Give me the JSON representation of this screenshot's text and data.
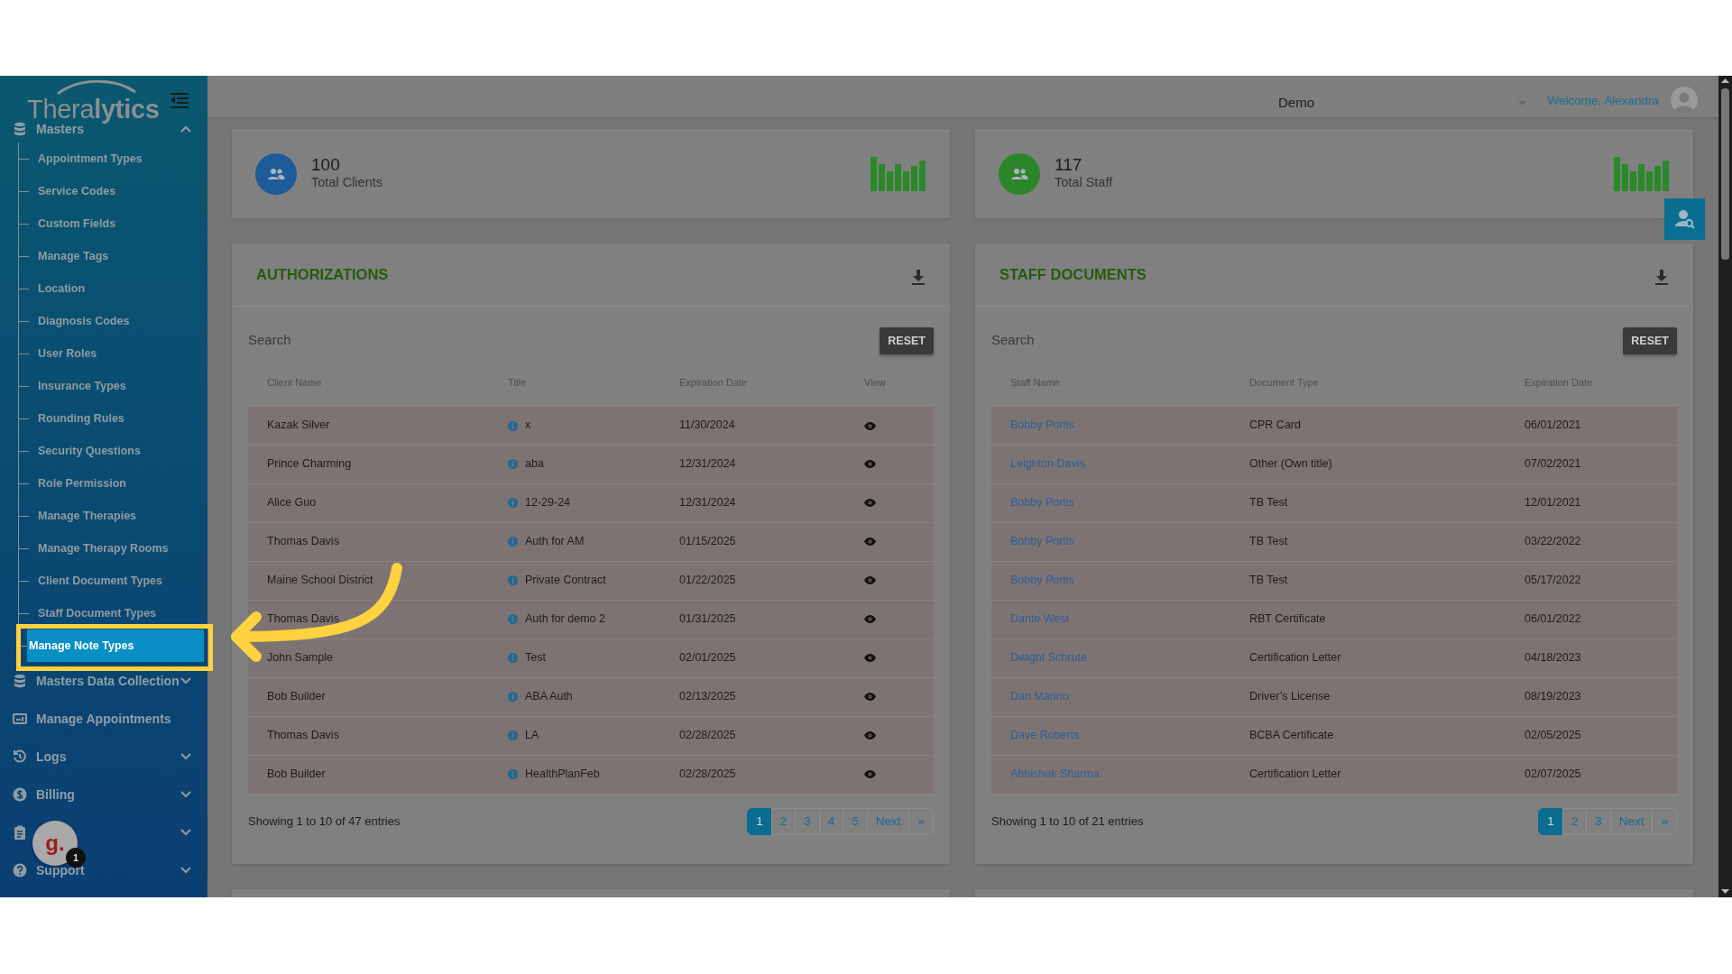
{
  "sidebar": {
    "logo": "Thera**lytics**",
    "groups": [
      {
        "kind": "database",
        "label": "Masters",
        "expanded": true,
        "children": [
          {
            "label": "Appointment Types",
            "selected": false
          },
          {
            "label": "Service Codes",
            "selected": false
          },
          {
            "label": "Custom Fields",
            "selected": false
          },
          {
            "label": "Manage Tags",
            "selected": false
          },
          {
            "label": "Location",
            "selected": false
          },
          {
            "label": "Diagnosis Codes",
            "selected": false
          },
          {
            "label": "User Roles",
            "selected": false
          },
          {
            "label": "Insurance Types",
            "selected": false
          },
          {
            "label": "Rounding Rules",
            "selected": false
          },
          {
            "label": "Security Questions",
            "selected": false
          },
          {
            "label": "Role Permission",
            "selected": false
          },
          {
            "label": "Manage Therapies",
            "selected": false
          },
          {
            "label": "Manage Therapy Rooms",
            "selected": false
          },
          {
            "label": "Client Document Types",
            "selected": false
          },
          {
            "label": "Staff Document Types",
            "selected": false
          },
          {
            "label": "Manage Note Types",
            "selected": true
          }
        ]
      },
      {
        "kind": "database",
        "label": "Masters Data Collection",
        "expanded": false
      },
      {
        "kind": "id-card",
        "label": "Manage Appointments"
      },
      {
        "kind": "history",
        "label": "Logs",
        "expanded": false
      },
      {
        "kind": "billing",
        "label": "Billing",
        "expanded": false
      },
      {
        "kind": "clipboard",
        "expanded": false
      },
      {
        "kind": "help",
        "label": "Support",
        "expanded": false
      }
    ]
  },
  "chat_widget": {
    "logo": "g.",
    "badge": "1"
  },
  "header": {
    "site": "Demo",
    "welcome": "Welcome, Alexandra"
  },
  "stats": [
    {
      "value": "100",
      "label": "Total Clients",
      "color": "#1d5c98"
    },
    {
      "value": "117",
      "label": "Total Staff",
      "color": "#2b852b"
    }
  ],
  "panels": [
    {
      "title": "AUTHORIZATIONS",
      "search_placeholder": "Search",
      "reset": "RESET",
      "columns": [
        {
          "label": "Client Name",
          "kind": "text"
        },
        {
          "label": "Title",
          "kind": "info"
        },
        {
          "label": "Expiration Date",
          "kind": "text"
        },
        {
          "label": "View",
          "kind": "view"
        }
      ],
      "rows": [
        [
          "Kazak Silver",
          "x",
          "11/30/2024"
        ],
        [
          "Prince Charming",
          "aba",
          "12/31/2024"
        ],
        [
          "Alice Guo",
          "12-29-24",
          "12/31/2024"
        ],
        [
          "Thomas Davis",
          "Auth for AM",
          "01/15/2025"
        ],
        [
          "Maine School District",
          "Private Contract",
          "01/22/2025"
        ],
        [
          "Thomas Davis",
          "Auth for demo 2",
          "01/31/2025"
        ],
        [
          "John Sample",
          "Test",
          "02/01/2025"
        ],
        [
          "Bob Builder",
          "ABA Auth",
          "02/13/2025"
        ],
        [
          "Thomas Davis",
          "LA",
          "02/28/2025"
        ],
        [
          "Bob Builder",
          "HealthPlanFeb",
          "02/28/2025"
        ]
      ],
      "info": "Showing 1 to 10 of 47 entries",
      "pages": [
        {
          "label": "1",
          "selected": true
        },
        {
          "label": "2",
          "selected": false
        },
        {
          "label": "3",
          "selected": false
        },
        {
          "label": "4",
          "selected": false
        },
        {
          "label": "5",
          "selected": false
        },
        {
          "label": "Next",
          "selected": false
        },
        {
          "label": "»",
          "selected": false
        }
      ]
    },
    {
      "title": "STAFF DOCUMENTS",
      "search_placeholder": "Search",
      "reset": "RESET",
      "columns": [
        {
          "label": "Staff Name",
          "kind": "link"
        },
        {
          "label": "Document Type",
          "kind": "text"
        },
        {
          "label": "Expiration Date",
          "kind": "text"
        }
      ],
      "rows": [
        [
          "Bobby Portis",
          "CPR Card",
          "06/01/2021"
        ],
        [
          "Leighton Davis",
          "Other (Own title)",
          "07/02/2021"
        ],
        [
          "Bobby Portis",
          "TB Test",
          "12/01/2021"
        ],
        [
          "Bobby Portis",
          "TB Test",
          "03/22/2022"
        ],
        [
          "Bobby Portis",
          "TB Test",
          "05/17/2022"
        ],
        [
          "Dante West",
          "RBT Certificate",
          "06/01/2022"
        ],
        [
          "Dwight Schrute",
          "Certification Letter",
          "04/18/2023"
        ],
        [
          "Dan Marino",
          "Driver’s License",
          "08/19/2023"
        ],
        [
          "Dave Roberts",
          "BCBA Certificate",
          "02/05/2025"
        ],
        [
          "Abhishek Sharma",
          "Certification Letter",
          "02/07/2025"
        ]
      ],
      "info": "Showing 1 to 10 of 21 entries",
      "pages": [
        {
          "label": "1",
          "selected": true
        },
        {
          "label": "2",
          "selected": false
        },
        {
          "label": "3",
          "selected": false
        },
        {
          "label": "Next",
          "selected": false
        },
        {
          "label": "»",
          "selected": false
        }
      ]
    }
  ]
}
